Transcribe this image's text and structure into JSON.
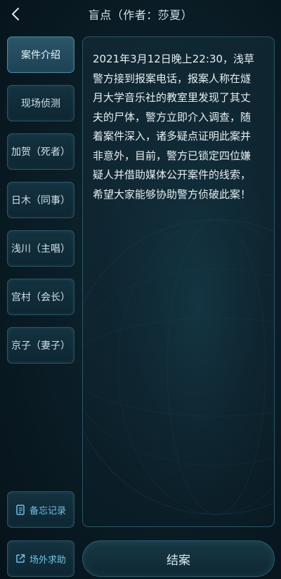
{
  "header": {
    "title": "盲点（作者：莎夏）",
    "back_icon": "chevron-left-icon"
  },
  "sidebar": {
    "items": [
      {
        "label": "案件介绍",
        "active": true
      },
      {
        "label": "现场侦测",
        "active": false
      },
      {
        "label": "加贺（死者）",
        "active": false
      },
      {
        "label": "日木（同事）",
        "active": false
      },
      {
        "label": "浅川（主唱）",
        "active": false
      },
      {
        "label": "宫村（会长）",
        "active": false
      },
      {
        "label": "京子（妻子）",
        "active": false
      }
    ],
    "memo": {
      "label": "备忘记录",
      "icon": "notebook-icon"
    },
    "help": {
      "label": "场外求助",
      "icon": "external-link-icon"
    }
  },
  "content": {
    "case_intro": "2021年3月12日晚上22:30，浅草\n警方接到报案电话，报案人称在燧\n月大学音乐社的教室里发现了其丈\n夫的尸体，警方立即介入调查，随\n着案件深入，诸多疑点证明此案并\n非意外，目前，警方已锁定四位嫌\n疑人并借助媒体公开案件的线索，\n希望大家能够协助警方侦破此案！"
  },
  "footer": {
    "close_case_label": "结案"
  },
  "colors": {
    "background": "#0a1c25",
    "border": "#2c5564",
    "accent": "#6fc3e6",
    "text": "#e6eef2"
  }
}
